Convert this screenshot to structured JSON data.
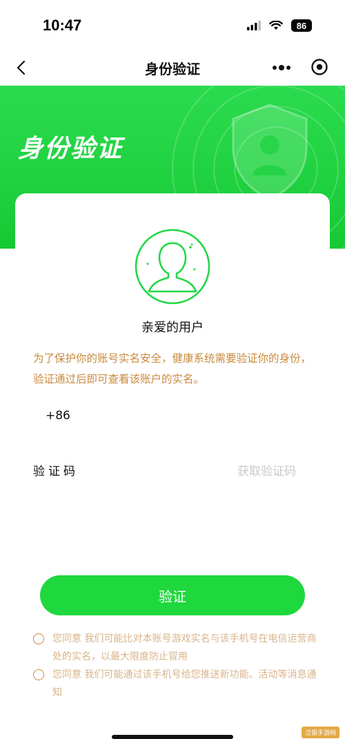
{
  "status_bar": {
    "time": "10:47",
    "battery": "86"
  },
  "nav": {
    "title": "身份验证"
  },
  "hero": {
    "title": "身份验证"
  },
  "card": {
    "greeting": "亲爱的用户",
    "notice": "为了保护你的账号实名安全，健康系统需要验证你的身份，验证通过后即可查看该账户的实名。",
    "phone_prefix": "+86",
    "phone_placeholder": "",
    "code_label": "验证码",
    "code_placeholder": "",
    "get_code": "获取验证码",
    "verify_label": "验证",
    "consents": [
      {
        "text": "您同意 我们可能比对本账号游戏实名与该手机号在电信运营商处的实名，以最大限度防止冒用"
      },
      {
        "text": "您同意 我们可能通过该手机号给您推送新功能、活动等消息通知"
      }
    ]
  },
  "watermark": "泛银手游网",
  "colors": {
    "accent": "#1fd83d",
    "notice": "#c98a3e",
    "consent": "#d8b48b"
  }
}
